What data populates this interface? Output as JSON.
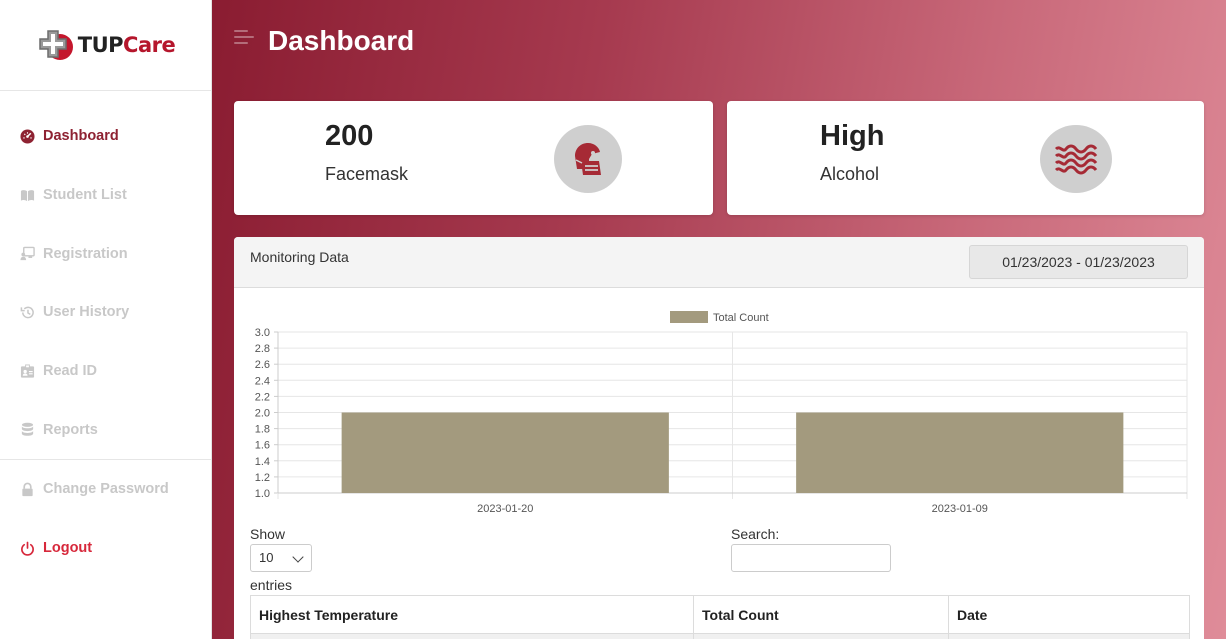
{
  "app": {
    "logo_prefix": "TUP",
    "logo_suffix": "Care"
  },
  "sidebar": {
    "items": [
      {
        "label": "Dashboard",
        "icon": "gauge-icon",
        "active": true
      },
      {
        "label": "Student List",
        "icon": "book-icon"
      },
      {
        "label": "Registration",
        "icon": "user-board-icon"
      },
      {
        "label": "User History",
        "icon": "history-icon"
      },
      {
        "label": "Read ID",
        "icon": "id-card-icon"
      },
      {
        "label": "Reports",
        "icon": "database-icon"
      },
      {
        "label": "Change Password",
        "icon": "lock-icon"
      },
      {
        "label": "Logout",
        "icon": "power-icon"
      }
    ]
  },
  "header": {
    "title": "Dashboard"
  },
  "stats": [
    {
      "value": "200",
      "label": "Facemask",
      "icon": "facemask-icon"
    },
    {
      "value": "High",
      "label": "Alcohol",
      "icon": "waves-icon"
    }
  ],
  "monitoring": {
    "title": "Monitoring Data",
    "date_range": "01/23/2023 - 01/23/2023"
  },
  "chart_data": {
    "type": "bar",
    "categories": [
      "2023-01-20",
      "2023-01-09"
    ],
    "series": [
      {
        "name": "Total Count",
        "values": [
          2,
          2
        ],
        "color": "#a39a7e"
      }
    ],
    "ylim": [
      1.0,
      3.0
    ],
    "yticks": [
      "1.0",
      "1.2",
      "1.4",
      "1.6",
      "1.8",
      "2.0",
      "2.2",
      "2.4",
      "2.6",
      "2.8",
      "3.0"
    ],
    "grid": true,
    "legend": "top-center"
  },
  "table_controls": {
    "show_label": "Show",
    "entries_value": "10",
    "entries_label": "entries",
    "search_label": "Search:",
    "search_value": ""
  },
  "table": {
    "columns": [
      "Highest Temperature",
      "Total Count",
      "Date"
    ]
  },
  "colors": {
    "accent": "#8e2232",
    "bar": "#a39a7e",
    "logout": "#d7283b"
  }
}
